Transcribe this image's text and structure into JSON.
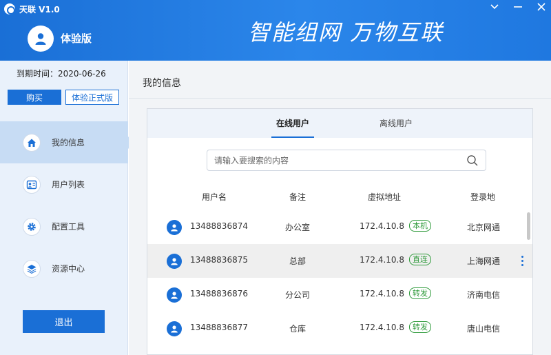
{
  "app": {
    "title": "天联 V1.0",
    "user_label": "体验版",
    "slogan": "智能组网  万物互联"
  },
  "window": {
    "minimize_glyph": "∨",
    "restore_glyph": "—",
    "close_glyph": "✕"
  },
  "sidebar": {
    "expire_text": "到期时间：2020-06-26",
    "buy_label": "购买",
    "trial_label": "体验正式版",
    "nav": [
      {
        "label": "我的信息",
        "icon": "home-icon",
        "active": true
      },
      {
        "label": "用户列表",
        "icon": "user-list-icon",
        "active": false
      },
      {
        "label": "配置工具",
        "icon": "gear-icon",
        "active": false
      },
      {
        "label": "资源中心",
        "icon": "layers-icon",
        "active": false
      }
    ],
    "logout_label": "退出"
  },
  "main": {
    "title": "我的信息",
    "tabs": [
      {
        "label": "在线用户",
        "active": true
      },
      {
        "label": "离线用户",
        "active": false
      }
    ],
    "search": {
      "placeholder": "请输入要搜索的内容",
      "value": ""
    },
    "columns": [
      "用户名",
      "备注",
      "虚拟地址",
      "登录地"
    ],
    "rows": [
      {
        "user": "13488836874",
        "note": "办公室",
        "ip": "172.4.10.8",
        "tag": "本机",
        "location": "北京网通"
      },
      {
        "user": "13488836875",
        "note": "总部",
        "ip": "172.4.10.8",
        "tag": "直连",
        "location": "上海网通"
      },
      {
        "user": "13488836876",
        "note": "分公司",
        "ip": "172.4.10.8",
        "tag": "转发",
        "location": "济南电信"
      },
      {
        "user": "13488836877",
        "note": "仓库",
        "ip": "172.4.10.8",
        "tag": "转发",
        "location": "唐山电信"
      }
    ]
  },
  "colors": {
    "primary": "#1a6fd6",
    "tag_green": "#2e9a3a",
    "sidebar_bg": "#e9f1fb",
    "active_nav": "#c7dcf4"
  }
}
